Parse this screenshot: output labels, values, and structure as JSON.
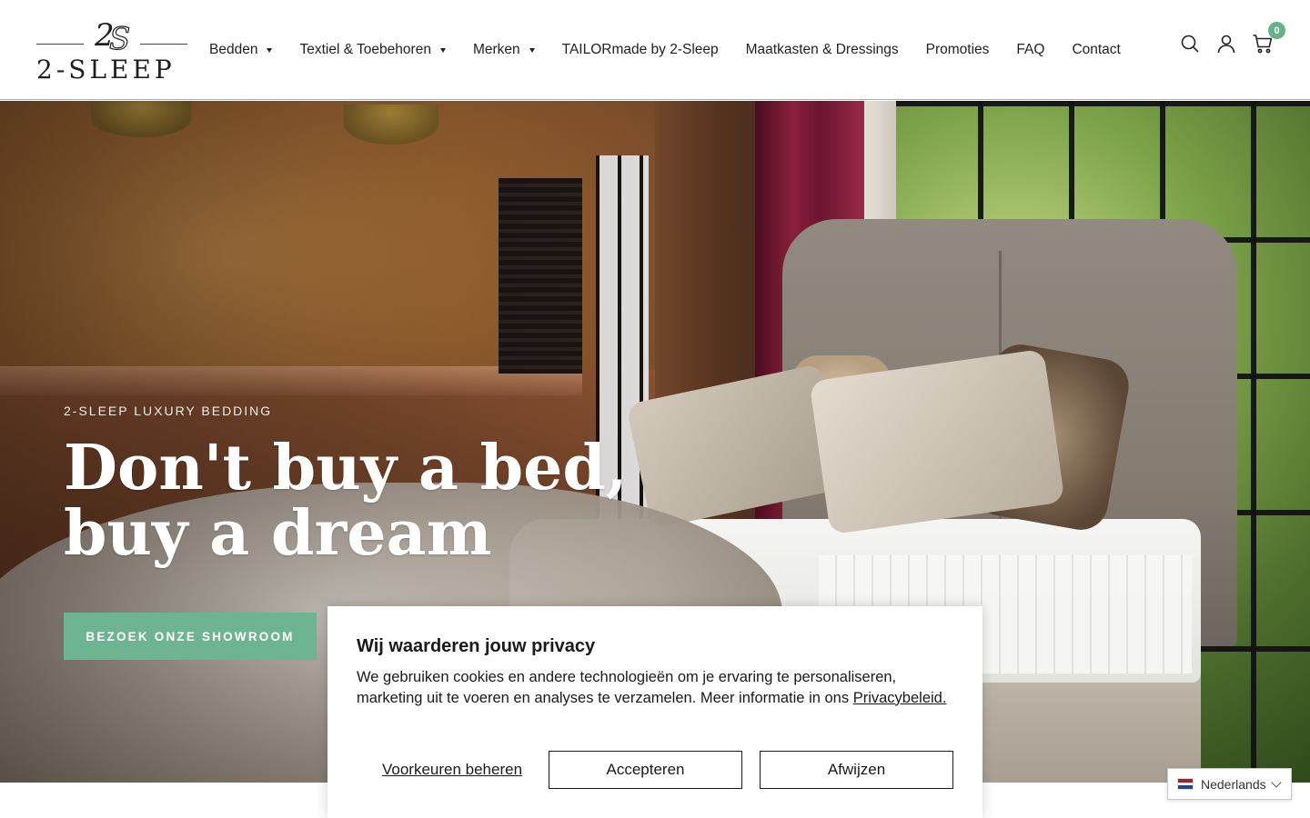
{
  "brand": {
    "name": "2-SLEEP",
    "monogram": "2S"
  },
  "nav": {
    "items": [
      {
        "label": "Bedden",
        "has_dropdown": true
      },
      {
        "label": "Textiel & Toebehoren",
        "has_dropdown": true
      },
      {
        "label": "Merken",
        "has_dropdown": true
      },
      {
        "label": "TAILORmade by 2-Sleep",
        "has_dropdown": false
      },
      {
        "label": "Maatkasten & Dressings",
        "has_dropdown": false
      },
      {
        "label": "Promoties",
        "has_dropdown": false
      },
      {
        "label": "FAQ",
        "has_dropdown": false
      },
      {
        "label": "Contact",
        "has_dropdown": false
      }
    ]
  },
  "header_icons": {
    "search": "search-icon",
    "account": "user-icon",
    "cart": "cart-icon",
    "cart_count": "0"
  },
  "hero": {
    "kicker": "2-SLEEP LUXURY BEDDING",
    "title_line1": "Don't buy a bed,",
    "title_line2": "buy a dream",
    "cta_label": "BEZOEK ONZE SHOWROOM"
  },
  "cookie": {
    "title": "Wij waarderen jouw privacy",
    "text": "We gebruiken cookies en andere technologieën om je ervaring te personaliseren, marketing uit te voeren en analyses te verzamelen. Meer informatie in ons",
    "link_label": "Privacybeleid.",
    "manage_label": "Voorkeuren beheren",
    "accept_label": "Accepteren",
    "decline_label": "Afwijzen"
  },
  "language": {
    "current": "Nederlands",
    "flag": "nl-flag-icon"
  },
  "colors": {
    "accent": "#6db590",
    "badge": "#66b08c",
    "text": "#1a1a1a",
    "header_border": "#9bb89f"
  }
}
